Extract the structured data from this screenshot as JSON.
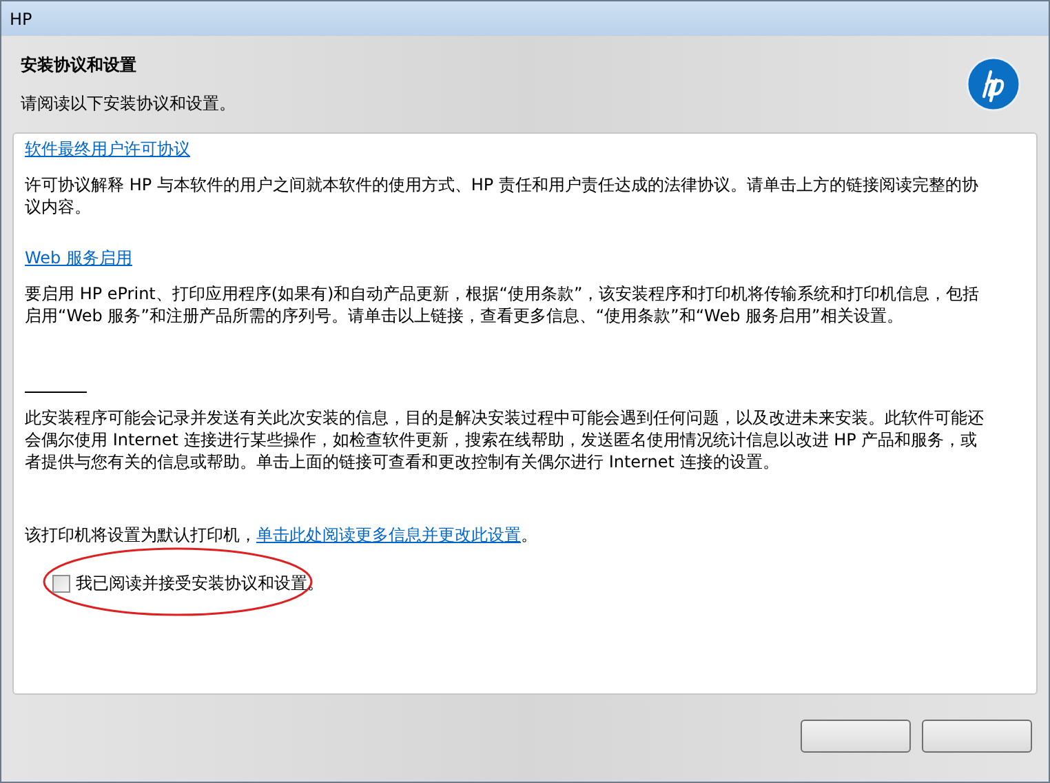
{
  "window": {
    "title": "HP"
  },
  "header": {
    "title": "安装协议和设置",
    "subtitle": "请阅读以下安装协议和设置。"
  },
  "sections": [
    {
      "kind": "link",
      "link": "软件最终用户许可协议",
      "text": "许可协议解释 HP 与本软件的用户之间就本软件的使用方式、HP 责任和用户责任达成的法律协议。请单击上方的链接阅读完整的协议内容。"
    },
    {
      "kind": "link",
      "link": "Web 服务启用",
      "text": "要启用 HP ePrint、打印应用程序(如果有)和自动产品更新，根据“使用条款”，该安装程序和打印机将传输系统和打印机信息，包括启用“Web 服务”和注册产品所需的序列号。请单击以上链接，查看更多信息、“使用条款”和“Web 服务启用”相关设置。"
    },
    {
      "kind": "rule",
      "text": "此安装程序可能会记录并发送有关此次安装的信息，目的是解决安装过程中可能会遇到任何问题，以及改进未来安装。此软件可能还会偶尔使用 Internet 连接进行某些操作，如检查软件更新，搜索在线帮助，发送匿名使用情况统计信息以改进 HP 产品和服务，或者提供与您有关的信息或帮助。单击上面的链接可查看和更改控制有关偶尔进行 Internet 连接的设置。"
    }
  ],
  "default_printer": {
    "text": "该打印机将设置为默认打印机，",
    "link": "单击此处阅读更多信息并更改此设置",
    "end": "。"
  },
  "accept": {
    "label": "我已阅读并接受安装协议和设置。",
    "checked": false
  }
}
